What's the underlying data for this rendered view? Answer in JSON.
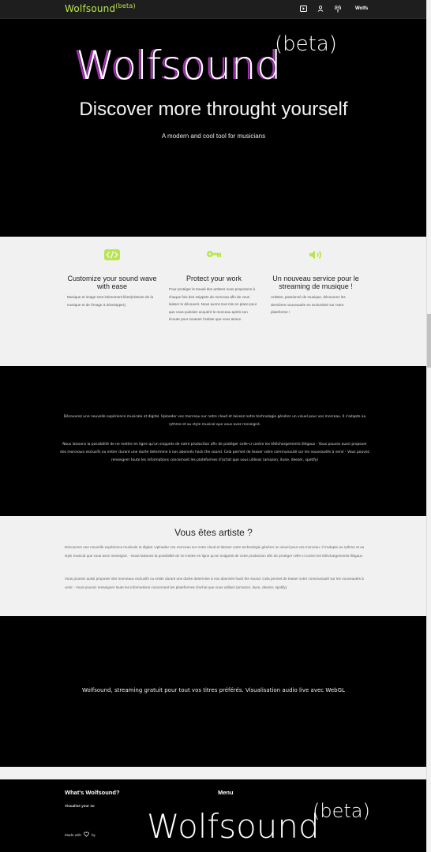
{
  "colors": {
    "accent": "#b8e64a",
    "magenta": "#c23bd4"
  },
  "navbar": {
    "brand": "Wolfsound",
    "brand_sup": "(beta)",
    "icons": [
      "play-square-icon",
      "user-icon",
      "podcast-icon"
    ],
    "user_label": "Wolfs"
  },
  "hero": {
    "logo_text": "Wolfsound",
    "logo_sup": "(beta)",
    "headline": "Discover more throught yourself",
    "subtitle": "A modern and cool tool for musicians"
  },
  "features": [
    {
      "icon": "code-icon",
      "title": "Customize your sound wave with ease",
      "text": "Musique et image sont intimement liées(Histoire de la musique et de l'image à développer)."
    },
    {
      "icon": "key-icon",
      "title": "Protect your work",
      "text": "Pour protéger le travail des artistes nous proposons à chaque fois des snippets de morceau afin de vous laisser le découvrir. Nous avons tout mis en place pour que vous puissiez acquérir le morceau après son écoute pour soutenir l'artiste que vous aimez."
    },
    {
      "icon": "volume-icon",
      "title": "Un nouveau service pour le streaming de musique !",
      "text": "Artistes, passionné de musique, découvrez les dernières nouveautés en exclusivité sur notre plateforme !"
    }
  ],
  "intro": {
    "p1": "Découvrez une nouvelle expérience musicale et digital. Uploader vos morceau sur notre cloud et laissez notre technologie générer un visuel pour vos morceau. Il s'adapte au rythme et au style musical que vous avez renseigné.",
    "p2": "Nous laissons la possibilité de ne mettre en ligne qu'un snippets de votre production afin de protéger celle-ci contre les téléchargements illégaux - Vous pouvez aussi proposer des morceaux exclusifs ou entier durant une durée determine à nos abonnés hack the sound. Cela permet de teaser votre communauté sur les nouveautés à venir - Vous pouvez renseigner toute les informations concernant les plateformes d'achat que vous utilisez (amazon, itune, deezer, spotify)"
  },
  "artist": {
    "title": "Vous êtes artiste ?",
    "p1": "Découvrez une nouvelle expérience musicale et digital. Uploader vos morceau sur notre cloud et laissez notre technologie générer un visuel pour vos morceau. Il s'adapte au rythme et au style musical que vous avez renseigné. - Nous laissons la possibilité de ne mettre en ligne qu'un snippets de votre production afin de protéger celle-ci contre les téléchargements illégaux",
    "p2": "Vous pouvez aussi proposer des morceaux exclusifs ou entier durant une durée determine à nos abonnés hack the sound. Cela permet de teaser votre communauté sur les nouveautés à venir - Vous pouvez renseigner toute les informations concernant les plateformes d'achat que vous utilisez (amazon, itune, deezer, spotify)"
  },
  "tagline": "Wolfsound, streaming gratuit pour tout vos titres préférés. Visualisation audio live avec WebGL",
  "footer": {
    "about_title": "What's Wolfsound?",
    "about_text": "Visualise your so",
    "menu_title": "Menu",
    "made_with": "Made with",
    "made_icon": "heart-icon",
    "by": "by",
    "logo_text": "Wolfsound",
    "logo_sup": "(beta)"
  }
}
